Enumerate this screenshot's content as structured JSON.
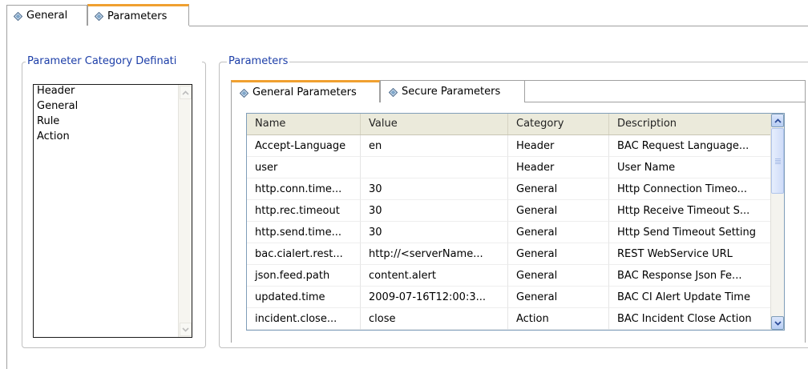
{
  "top_tabs": [
    {
      "label": "General",
      "icon": "diamond-icon",
      "selected": false
    },
    {
      "label": "Parameters",
      "icon": "diamond-icon",
      "selected": true
    }
  ],
  "category_group": {
    "title": "Parameter Category Definati",
    "items": [
      "Header",
      "General",
      "Rule",
      "Action"
    ]
  },
  "parameters_group": {
    "title": "Parameters",
    "tabs": [
      {
        "label": "General Parameters",
        "icon": "diamond-icon",
        "selected": true
      },
      {
        "label": "Secure Parameters",
        "icon": "diamond-icon",
        "selected": false
      }
    ],
    "table": {
      "columns": [
        "Name",
        "Value",
        "Category",
        "Description"
      ],
      "rows": [
        [
          "Accept-Language",
          "en",
          "Header",
          "BAC Request Language..."
        ],
        [
          "user",
          "",
          "Header",
          "User Name"
        ],
        [
          "http.conn.time...",
          "30",
          "General",
          "Http Connection Timeo..."
        ],
        [
          "http.rec.timeout",
          "30",
          "General",
          "Http Receive Timeout S..."
        ],
        [
          "http.send.time...",
          "30",
          "General",
          "Http Send Timeout Setting"
        ],
        [
          "bac.cialert.rest...",
          "http://<serverName...",
          "General",
          "REST WebService URL"
        ],
        [
          "json.feed.path",
          "content.alert",
          "General",
          "BAC Response Json Fe..."
        ],
        [
          "updated.time",
          "2009-07-16T12:00:3...",
          "General",
          "BAC CI Alert Update Time"
        ],
        [
          "incident.close...",
          "close",
          "Action",
          "BAC Incident Close Action"
        ]
      ]
    }
  },
  "colors": {
    "tab_accent": "#f0a030",
    "group_title": "#1c3ea8",
    "diamond_fill": "#7fa6c9"
  }
}
